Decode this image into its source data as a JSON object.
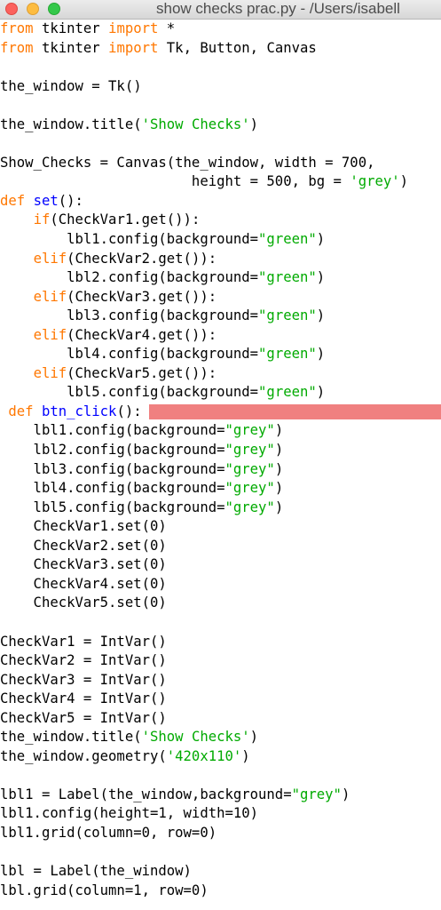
{
  "window": {
    "title": "show checks prac.py - /Users/isabell"
  },
  "colors": {
    "keyword": "#ff7700",
    "definition": "#0000ff",
    "string": "#00aa00",
    "text": "#000000",
    "highlight": "#f08080"
  },
  "code": [
    {
      "tokens": [
        {
          "t": "kw",
          "v": "from"
        },
        {
          "t": "plain",
          "v": " tkinter "
        },
        {
          "t": "kw",
          "v": "import"
        },
        {
          "t": "plain",
          "v": " *"
        }
      ]
    },
    {
      "tokens": [
        {
          "t": "kw",
          "v": "from"
        },
        {
          "t": "plain",
          "v": " tkinter "
        },
        {
          "t": "kw",
          "v": "import"
        },
        {
          "t": "plain",
          "v": " Tk, Button, Canvas"
        }
      ]
    },
    {
      "tokens": []
    },
    {
      "tokens": [
        {
          "t": "plain",
          "v": "the_window = Tk()"
        }
      ]
    },
    {
      "tokens": []
    },
    {
      "tokens": [
        {
          "t": "plain",
          "v": "the_window.title("
        },
        {
          "t": "str",
          "v": "'Show Checks'"
        },
        {
          "t": "plain",
          "v": ")"
        }
      ]
    },
    {
      "tokens": []
    },
    {
      "tokens": [
        {
          "t": "plain",
          "v": "Show_Checks = Canvas(the_window, width = 700,"
        }
      ]
    },
    {
      "tokens": [
        {
          "t": "plain",
          "v": "                       height = 500, bg = "
        },
        {
          "t": "str",
          "v": "'grey'"
        },
        {
          "t": "plain",
          "v": ")"
        }
      ]
    },
    {
      "tokens": [
        {
          "t": "kw",
          "v": "def"
        },
        {
          "t": "plain",
          "v": " "
        },
        {
          "t": "def",
          "v": "set"
        },
        {
          "t": "plain",
          "v": "():"
        }
      ]
    },
    {
      "tokens": [
        {
          "t": "plain",
          "v": "    "
        },
        {
          "t": "kw",
          "v": "if"
        },
        {
          "t": "plain",
          "v": "(CheckVar1.get()):"
        }
      ]
    },
    {
      "tokens": [
        {
          "t": "plain",
          "v": "        lbl1.config(background="
        },
        {
          "t": "str",
          "v": "\"green\""
        },
        {
          "t": "plain",
          "v": ")"
        }
      ]
    },
    {
      "tokens": [
        {
          "t": "plain",
          "v": "    "
        },
        {
          "t": "kw",
          "v": "elif"
        },
        {
          "t": "plain",
          "v": "(CheckVar2.get()):"
        }
      ]
    },
    {
      "tokens": [
        {
          "t": "plain",
          "v": "        lbl2.config(background="
        },
        {
          "t": "str",
          "v": "\"green\""
        },
        {
          "t": "plain",
          "v": ")"
        }
      ]
    },
    {
      "tokens": [
        {
          "t": "plain",
          "v": "    "
        },
        {
          "t": "kw",
          "v": "elif"
        },
        {
          "t": "plain",
          "v": "(CheckVar3.get()):"
        }
      ]
    },
    {
      "tokens": [
        {
          "t": "plain",
          "v": "        lbl3.config(background="
        },
        {
          "t": "str",
          "v": "\"green\""
        },
        {
          "t": "plain",
          "v": ")"
        }
      ]
    },
    {
      "tokens": [
        {
          "t": "plain",
          "v": "    "
        },
        {
          "t": "kw",
          "v": "elif"
        },
        {
          "t": "plain",
          "v": "(CheckVar4.get()):"
        }
      ]
    },
    {
      "tokens": [
        {
          "t": "plain",
          "v": "        lbl4.config(background="
        },
        {
          "t": "str",
          "v": "\"green\""
        },
        {
          "t": "plain",
          "v": ")"
        }
      ]
    },
    {
      "tokens": [
        {
          "t": "plain",
          "v": "    "
        },
        {
          "t": "kw",
          "v": "elif"
        },
        {
          "t": "plain",
          "v": "(CheckVar5.get()):"
        }
      ]
    },
    {
      "tokens": [
        {
          "t": "plain",
          "v": "        lbl5.config(background="
        },
        {
          "t": "str",
          "v": "\"green\""
        },
        {
          "t": "plain",
          "v": ")"
        }
      ]
    },
    {
      "highlight": true,
      "tokens": [
        {
          "t": "plain",
          "v": " "
        },
        {
          "t": "kw",
          "v": "def"
        },
        {
          "t": "plain",
          "v": " "
        },
        {
          "t": "def",
          "v": "btn_click"
        },
        {
          "t": "plain",
          "v": "():"
        }
      ]
    },
    {
      "tokens": [
        {
          "t": "plain",
          "v": "    lbl1.config(background="
        },
        {
          "t": "str",
          "v": "\"grey\""
        },
        {
          "t": "plain",
          "v": ")"
        }
      ]
    },
    {
      "tokens": [
        {
          "t": "plain",
          "v": "    lbl2.config(background="
        },
        {
          "t": "str",
          "v": "\"grey\""
        },
        {
          "t": "plain",
          "v": ")"
        }
      ]
    },
    {
      "tokens": [
        {
          "t": "plain",
          "v": "    lbl3.config(background="
        },
        {
          "t": "str",
          "v": "\"grey\""
        },
        {
          "t": "plain",
          "v": ")"
        }
      ]
    },
    {
      "tokens": [
        {
          "t": "plain",
          "v": "    lbl4.config(background="
        },
        {
          "t": "str",
          "v": "\"grey\""
        },
        {
          "t": "plain",
          "v": ")"
        }
      ]
    },
    {
      "tokens": [
        {
          "t": "plain",
          "v": "    lbl5.config(background="
        },
        {
          "t": "str",
          "v": "\"grey\""
        },
        {
          "t": "plain",
          "v": ")"
        }
      ]
    },
    {
      "tokens": [
        {
          "t": "plain",
          "v": "    CheckVar1.set(0)"
        }
      ]
    },
    {
      "tokens": [
        {
          "t": "plain",
          "v": "    CheckVar2.set(0)"
        }
      ]
    },
    {
      "tokens": [
        {
          "t": "plain",
          "v": "    CheckVar3.set(0)"
        }
      ]
    },
    {
      "tokens": [
        {
          "t": "plain",
          "v": "    CheckVar4.set(0)"
        }
      ]
    },
    {
      "tokens": [
        {
          "t": "plain",
          "v": "    CheckVar5.set(0)"
        }
      ]
    },
    {
      "tokens": []
    },
    {
      "tokens": [
        {
          "t": "plain",
          "v": "CheckVar1 = IntVar()"
        }
      ]
    },
    {
      "tokens": [
        {
          "t": "plain",
          "v": "CheckVar2 = IntVar()"
        }
      ]
    },
    {
      "tokens": [
        {
          "t": "plain",
          "v": "CheckVar3 = IntVar()"
        }
      ]
    },
    {
      "tokens": [
        {
          "t": "plain",
          "v": "CheckVar4 = IntVar()"
        }
      ]
    },
    {
      "tokens": [
        {
          "t": "plain",
          "v": "CheckVar5 = IntVar()"
        }
      ]
    },
    {
      "tokens": [
        {
          "t": "plain",
          "v": "the_window.title("
        },
        {
          "t": "str",
          "v": "'Show Checks'"
        },
        {
          "t": "plain",
          "v": ")"
        }
      ]
    },
    {
      "tokens": [
        {
          "t": "plain",
          "v": "the_window.geometry("
        },
        {
          "t": "str",
          "v": "'420x110'"
        },
        {
          "t": "plain",
          "v": ")"
        }
      ]
    },
    {
      "tokens": []
    },
    {
      "tokens": [
        {
          "t": "plain",
          "v": "lbl1 = Label(the_window,background="
        },
        {
          "t": "str",
          "v": "\"grey\""
        },
        {
          "t": "plain",
          "v": ")"
        }
      ]
    },
    {
      "tokens": [
        {
          "t": "plain",
          "v": "lbl1.config(height=1, width=10)"
        }
      ]
    },
    {
      "tokens": [
        {
          "t": "plain",
          "v": "lbl1.grid(column=0, row=0)"
        }
      ]
    },
    {
      "tokens": []
    },
    {
      "tokens": [
        {
          "t": "plain",
          "v": "lbl = Label(the_window)"
        }
      ]
    },
    {
      "tokens": [
        {
          "t": "plain",
          "v": "lbl.grid(column=1, row=0)"
        }
      ]
    }
  ]
}
